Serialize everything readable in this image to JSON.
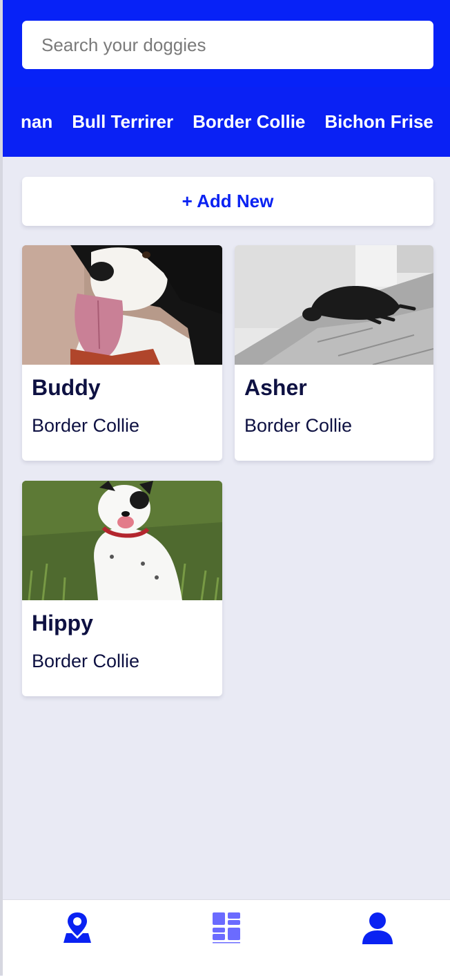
{
  "search": {
    "placeholder": "Search your doggies"
  },
  "breeds": [
    "nan",
    "Bull Terrirer",
    "Border Collie",
    "Bichon Frise"
  ],
  "add_button": {
    "label": "+ Add New"
  },
  "dogs": [
    {
      "name": "Buddy",
      "breed": "Border Collie"
    },
    {
      "name": "Asher",
      "breed": "Border Collie"
    },
    {
      "name": "Hippy",
      "breed": "Border Collie"
    }
  ],
  "nav": [
    {
      "icon": "map-pin-icon"
    },
    {
      "icon": "grid-icon"
    },
    {
      "icon": "user-icon"
    }
  ],
  "colors": {
    "brand": "#0a22f2",
    "background": "#e9eaf4",
    "text_dark": "#0e1142"
  }
}
